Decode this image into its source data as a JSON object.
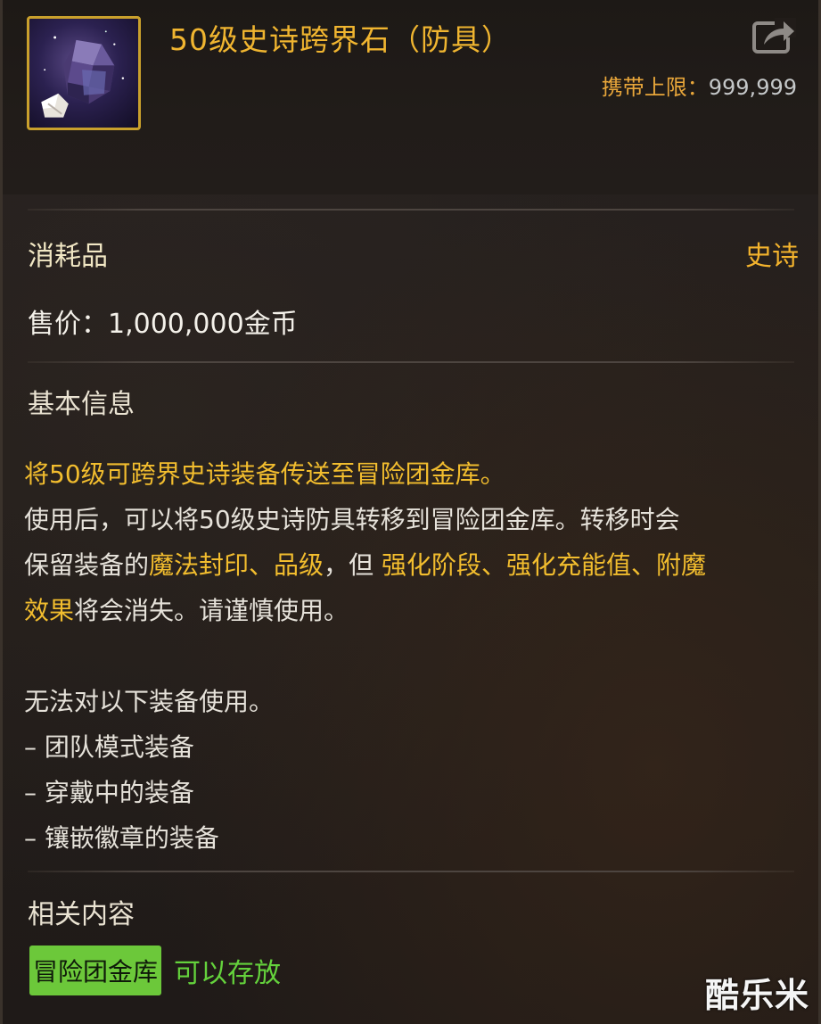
{
  "header": {
    "item_icon": "crystal-stone-icon",
    "title": "50级史诗跨界石（防具）",
    "share_icon": "share-icon",
    "carry_limit_label": "携带上限：",
    "carry_limit_value": "999,999"
  },
  "info": {
    "category": "消耗品",
    "rarity": "史诗",
    "price": "售价：1,000,000金币"
  },
  "basic_info": {
    "title": "基本信息",
    "line1": "将50级可跨界史诗装备传送至冒险团金库。",
    "line2": "使用后，可以将50级史诗防具转移到冒险团金库。转移时会",
    "line3_a": "保留装备的",
    "line3_b": "魔法封印、品级",
    "line3_c": "，但 ",
    "line3_d": "强化阶段、强化充能值、附魔",
    "line4_a": "效果",
    "line4_b": "将会消失。请谨慎使用。",
    "restrict_title": "无法对以下装备使用。",
    "restrict_items": [
      "– 团队模式装备",
      "– 穿戴中的装备",
      "– 镶嵌徽章的装备"
    ]
  },
  "related": {
    "title": "相关内容",
    "tag": "冒险团金库",
    "status": "可以存放"
  },
  "watermark": "酷乐米",
  "colors": {
    "title_gold": "#f0b530",
    "highlight_gold": "#f2bd2e",
    "tag_green": "#6cc83a",
    "status_green": "#64d23c",
    "icon_border": "#c9a02c"
  }
}
